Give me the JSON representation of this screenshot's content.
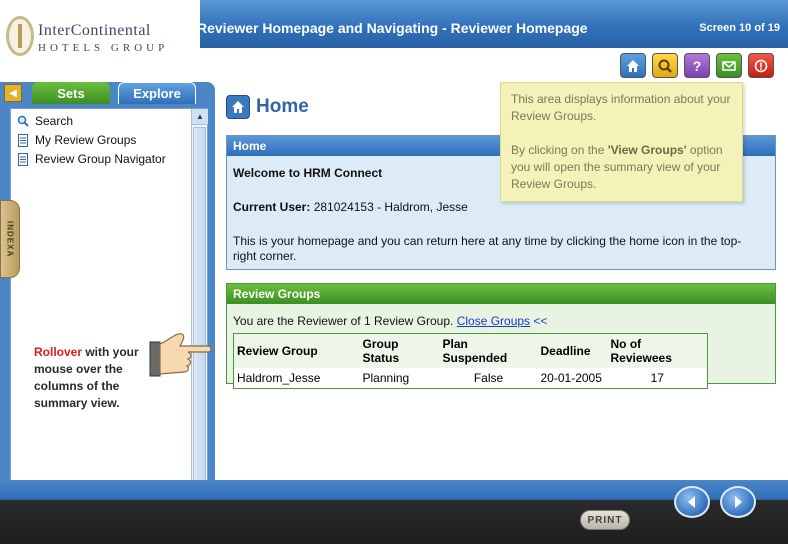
{
  "banner": {
    "logo_line1": "InterContinental",
    "logo_line2": "HOTELS GROUP",
    "title": "Reviewer Homepage and Navigating - Reviewer Homepage",
    "screen_count": "Screen 10 of 19"
  },
  "toolbar": {
    "icons": [
      "home-icon",
      "search-icon",
      "help-icon",
      "mail-icon",
      "exit-icon"
    ],
    "help_glyph": "?"
  },
  "left": {
    "tabs": [
      "Sets",
      "Explore"
    ],
    "tree_items": [
      "Search",
      "My Review Groups",
      "Review Group Navigator"
    ],
    "index_label": "INDEXA"
  },
  "rollover": {
    "highlight": "Rollover",
    "rest": " with your mouse over the columns of the summary view."
  },
  "main": {
    "heading": "Home",
    "home_panel": {
      "title": "Home",
      "welcome": "Welcome to HRM Connect",
      "current_user_label": "Current User:",
      "current_user_value": "281024153 - Haldrom, Jesse",
      "info": "This is your homepage and you can return here at any time by clicking the home icon in the top-right corner."
    },
    "rg_panel": {
      "title": "Review Groups",
      "summary": "You are the Reviewer of 1 Review Group.",
      "close_link": "Close Groups",
      "close_suffix": "<<",
      "columns": [
        "Review Group",
        "Group Status",
        "Plan Suspended",
        "Deadline",
        "No of Reviewees"
      ],
      "rows": [
        [
          "Haldrom_Jesse",
          "Planning",
          "False",
          "20-01-2005",
          "17"
        ]
      ]
    }
  },
  "tooltip": {
    "line1": "This area displays information about your Review Groups.",
    "line2_pre": "By clicking on the ",
    "line2_bold": "'View Groups'",
    "line2_post": " option you will open the summary view of your Review Groups."
  },
  "footer": {
    "print_label": "PRINT"
  },
  "colors": {
    "blue_header": "#2f6fb8",
    "green_header": "#3b8f23",
    "tooltip_bg": "#f4f2b8",
    "rollover_red": "#e21c1c"
  }
}
